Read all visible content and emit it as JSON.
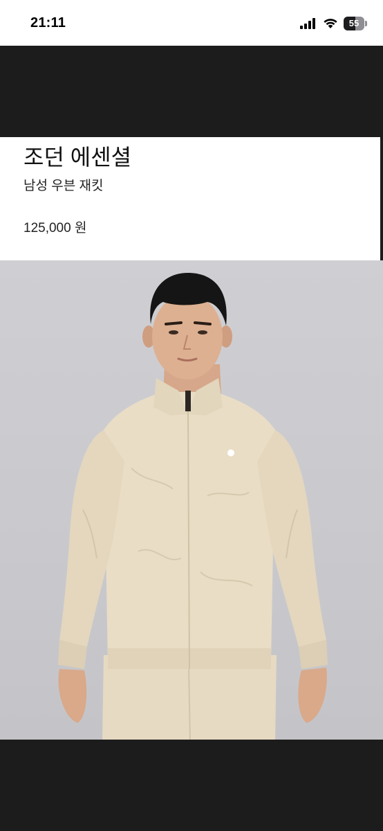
{
  "status_bar": {
    "time": "21:11",
    "battery_level": "55",
    "icons": [
      "cellular-signal-icon",
      "wifi-icon",
      "battery-icon"
    ]
  },
  "product": {
    "title": "조던 에센셜",
    "subtitle": "남성 우븐 재킷",
    "price": "125,000 원",
    "image_alt": "product-photo-man-in-beige-woven-jacket"
  },
  "colors": {
    "band": "#1c1c1c",
    "photo_background": "#cbcbcf",
    "jacket": "#e8dcc4"
  }
}
